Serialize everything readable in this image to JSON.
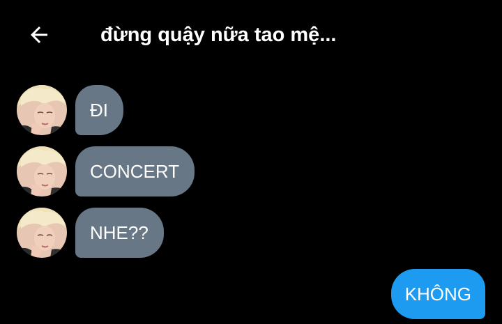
{
  "header": {
    "title": "đừng quậy nữa tao mệ...",
    "back_icon": "arrow-left-icon"
  },
  "messages": [
    {
      "direction": "incoming",
      "text": "ĐI"
    },
    {
      "direction": "incoming",
      "text": "CONCERT"
    },
    {
      "direction": "incoming",
      "text": "NHE??"
    },
    {
      "direction": "outgoing",
      "text": "KHÔNG"
    }
  ],
  "colors": {
    "background": "#000000",
    "incoming_bubble": "#687785",
    "outgoing_bubble": "#1d9bf0",
    "text": "#ffffff"
  }
}
